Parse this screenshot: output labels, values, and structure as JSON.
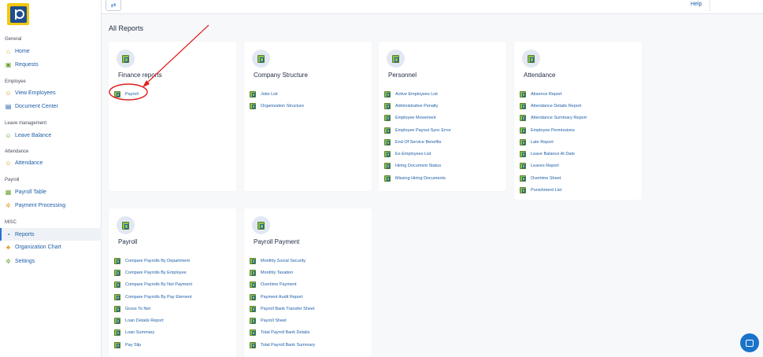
{
  "topbar": {
    "menu_icon": "sync-arrows-icon",
    "help_label": "Help"
  },
  "sidebar": {
    "sections": [
      {
        "label": "General",
        "items": [
          {
            "label": "Home",
            "icon": "home-icon"
          },
          {
            "label": "Requests",
            "icon": "requests-icon"
          }
        ]
      },
      {
        "label": "Employee",
        "items": [
          {
            "label": "View Employees",
            "icon": "person-icon"
          },
          {
            "label": "Document Center",
            "icon": "document-icon"
          }
        ]
      },
      {
        "label": "Leave management",
        "items": [
          {
            "label": "Leave Balance",
            "icon": "person-leave-icon"
          }
        ]
      },
      {
        "label": "Attendance",
        "items": [
          {
            "label": "Attendance",
            "icon": "person-clock-icon"
          }
        ]
      },
      {
        "label": "Payroll",
        "items": [
          {
            "label": "Payroll Table",
            "icon": "table-icon"
          },
          {
            "label": "Payment Processing",
            "icon": "gear-icon"
          }
        ]
      },
      {
        "label": "MISC",
        "items": [
          {
            "label": "Reports",
            "icon": "report-icon",
            "active": true
          },
          {
            "label": "Organization Chart",
            "icon": "org-chart-icon"
          },
          {
            "label": "Settings",
            "icon": "gear-icon"
          }
        ]
      }
    ]
  },
  "main": {
    "title": "All Reports",
    "cards": [
      {
        "title": "Finance reports",
        "items": [
          "Payroll"
        ]
      },
      {
        "title": "Company Structure",
        "items": [
          "Jobs List",
          "Organization Structure"
        ]
      },
      {
        "title": "Personnel",
        "items": [
          "Active Employees List",
          "Administrative Penalty",
          "Employee Movement",
          "Employee Payout Sync Error",
          "End Of Service Benefits",
          "Ex-Employees List",
          "Hiring Document Status",
          "Missing Hiring Documents"
        ]
      },
      {
        "title": "Attendance",
        "items": [
          "Absence Report",
          "Attendance Details Report",
          "Attendance Summary Report",
          "Employee Permissions",
          "Late Report",
          "Leave Balance At Date",
          "Leaves Report",
          "Overtime Sheet",
          "Punishment List"
        ]
      },
      {
        "title": "Payroll",
        "items": [
          "Compare Payrolls By Department",
          "Compare Payrolls By Employee",
          "Compare Payrolls By Net Payment",
          "Compare Payrolls By Pay Element",
          "Gross To Net",
          "Loan Details Report",
          "Loan Summary",
          "Pay Slip"
        ]
      },
      {
        "title": "Payroll Payment",
        "items": [
          "Monthly Social Security",
          "Monthly Taxation",
          "Overtime Payment",
          "Payment Audit Report",
          "Payroll Bank Transfer Sheet",
          "Payroll Sheet",
          "Total Payroll Bank Details",
          "Total Payroll Bank Summary"
        ]
      }
    ]
  },
  "colors": {
    "accent": "#1d5ea8",
    "annotation": "#e0201c",
    "chat_button": "#1a73c9"
  },
  "chat": {
    "icon": "chat-icon"
  }
}
